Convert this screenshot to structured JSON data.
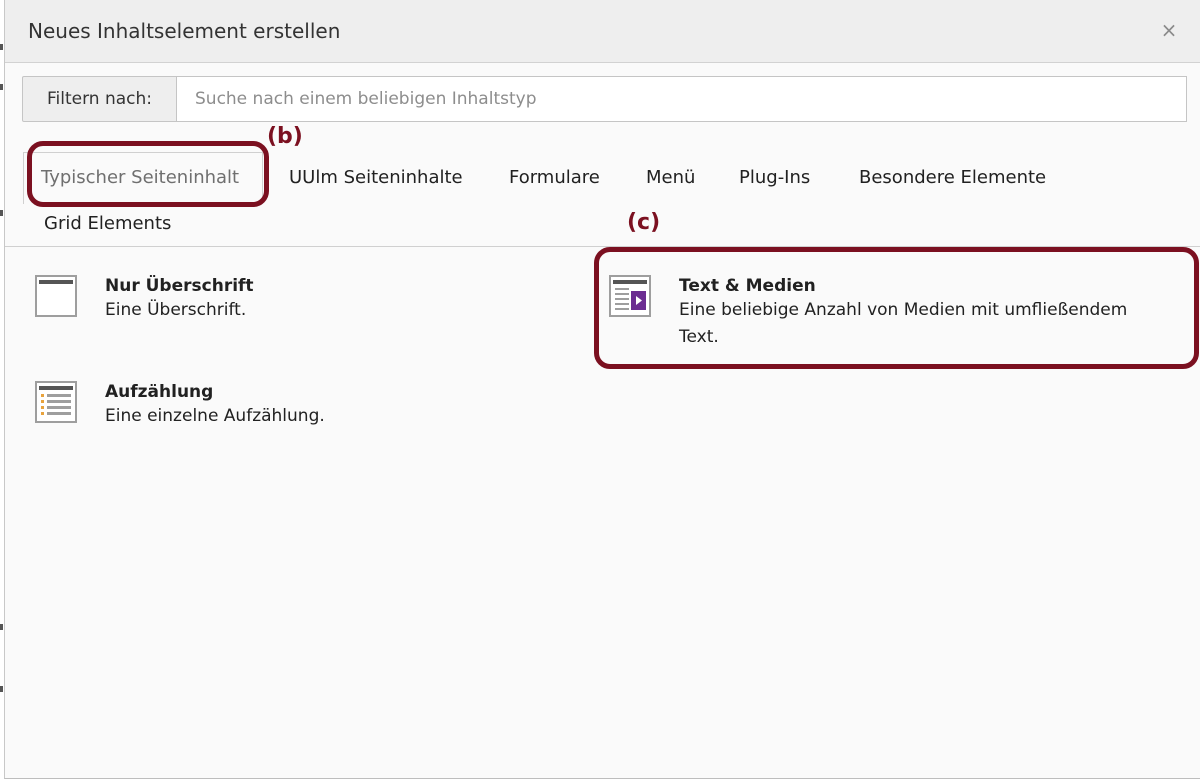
{
  "dialog": {
    "title": "Neues Inhaltselement erstellen",
    "close_glyph": "×"
  },
  "filter": {
    "label": "Filtern nach:",
    "placeholder": "Suche nach einem beliebigen Inhaltstyp",
    "value": ""
  },
  "tabs": [
    {
      "label": "Typischer Seiteninhalt",
      "active": true
    },
    {
      "label": "UUlm Seiteninhalte",
      "active": false
    },
    {
      "label": "Formulare",
      "active": false
    },
    {
      "label": "Menü",
      "active": false
    },
    {
      "label": "Plug-Ins",
      "active": false
    },
    {
      "label": "Besondere Elemente",
      "active": false
    },
    {
      "label": "Grid Elements",
      "active": false
    }
  ],
  "items": [
    {
      "title": "Nur Überschrift",
      "description": "Eine Überschrift.",
      "icon": "header-icon"
    },
    {
      "title": "Text & Medien",
      "description_line1": "Eine beliebige Anzahl von Medien mit umfließendem",
      "description_line2": "Text.",
      "icon": "textmedia-icon"
    },
    {
      "title": "Aufzählung",
      "description": "Eine einzelne Aufzählung.",
      "icon": "bullets-icon"
    }
  ],
  "annotations": {
    "b": "(b)",
    "c": "(c)",
    "color": "#7b1020"
  },
  "colors": {
    "accent_purple": "#6b2c91",
    "bullet_orange": "#e8a33d"
  }
}
